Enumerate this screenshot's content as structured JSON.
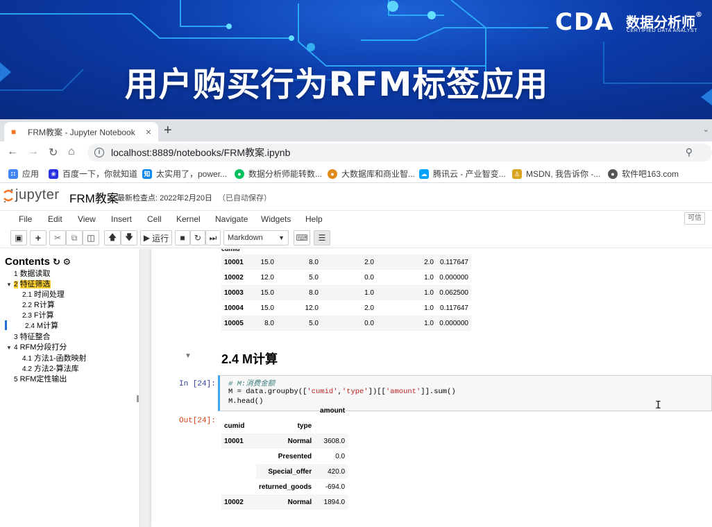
{
  "banner": {
    "title": "用户购买行为RFM标签应用",
    "logo_text": "CDA",
    "logo_cn": "数据分析师",
    "logo_en": "CERTIFIED DATA ANALYST",
    "logo_mark": "®"
  },
  "browser": {
    "tab_title": "FRM教案 - Jupyter Notebook",
    "tab_close": "×",
    "new_tab": "+",
    "url": "localhost:8889/notebooks/FRM教案.ipynb",
    "bookmarks": [
      {
        "label": "应用",
        "icon": "apps-grid-icon",
        "color": "#4285f4"
      },
      {
        "label": "百度一下，你就知道",
        "icon": "baidu-paw-icon",
        "color": "#2932e1"
      },
      {
        "label": "太实用了，power...",
        "icon": "zhihu-icon",
        "color": "#0f88eb"
      },
      {
        "label": "数据分析师能转数...",
        "icon": "wechat-icon",
        "color": "#07c160"
      },
      {
        "label": "大数据库和商业智...",
        "icon": "globe-icon",
        "color": "#e08a1e"
      },
      {
        "label": "腾讯云 - 产业智变...",
        "icon": "tencent-cloud-icon",
        "color": "#00a3ff"
      },
      {
        "label": "MSDN, 我告诉你 -...",
        "icon": "msdn-figure-icon",
        "color": "#d9a521"
      },
      {
        "label": "软件吧163.com",
        "icon": "site-globe-icon",
        "color": "#555555"
      }
    ]
  },
  "jupyter": {
    "logo_word": "jupyter",
    "notebook_name": "FRM教案",
    "checkpoint": "最新检查点: 2022年2月20日",
    "autosave": "（已自动保存）",
    "menus": [
      "File",
      "Edit",
      "View",
      "Insert",
      "Cell",
      "Kernel",
      "Navigate",
      "Widgets",
      "Help"
    ],
    "trusted": "可信",
    "run_label": "运行",
    "cell_type": "Markdown"
  },
  "toc": {
    "title": "Contents",
    "items": [
      {
        "num": "1",
        "label": "数据读取"
      },
      {
        "num": "2",
        "label": "特征筛选"
      },
      {
        "num": "2.1",
        "label": "时间处理"
      },
      {
        "num": "2.2",
        "label": "R计算"
      },
      {
        "num": "2.3",
        "label": "F计算"
      },
      {
        "num": "2.4",
        "label": "M计算"
      },
      {
        "num": "3",
        "label": "特征整合"
      },
      {
        "num": "4",
        "label": "RFM分段打分"
      },
      {
        "num": "4.1",
        "label": "方法1-函数映射"
      },
      {
        "num": "4.2",
        "label": "方法2-算法库"
      },
      {
        "num": "5",
        "label": "RFM定性输出"
      }
    ]
  },
  "cells": {
    "top_table": {
      "index_name": "cumid",
      "rows": [
        [
          "10001",
          "15.0",
          "8.0",
          "2.0",
          "2.0",
          "0.117647"
        ],
        [
          "10002",
          "12.0",
          "5.0",
          "0.0",
          "1.0",
          "0.000000"
        ],
        [
          "10003",
          "15.0",
          "8.0",
          "1.0",
          "1.0",
          "0.062500"
        ],
        [
          "10004",
          "15.0",
          "12.0",
          "2.0",
          "1.0",
          "0.117647"
        ],
        [
          "10005",
          "8.0",
          "5.0",
          "0.0",
          "1.0",
          "0.000000"
        ]
      ]
    },
    "heading": "2.4  M计算",
    "in_prompt": "In  [24]:",
    "code": {
      "comment": "# M:消费金额",
      "line2_a": "M = data.groupby([",
      "line2_s1": "'cumid'",
      "line2_b": ",",
      "line2_s2": "'type'",
      "line2_c": "])[[",
      "line2_s3": "'amount'",
      "line2_d": "]].sum()",
      "line3": "M.head()"
    },
    "out_prompt": "Out[24]:",
    "m_table": {
      "column": "amount",
      "index_names": [
        "cumid",
        "type"
      ],
      "rows": [
        {
          "cumid": "10001",
          "type": "Normal",
          "amount": "3608.0"
        },
        {
          "cumid": "",
          "type": "Presented",
          "amount": "0.0"
        },
        {
          "cumid": "",
          "type": "Special_offer",
          "amount": "420.0"
        },
        {
          "cumid": "",
          "type": "returned_goods",
          "amount": "-694.0"
        },
        {
          "cumid": "10002",
          "type": "Normal",
          "amount": "1894.0"
        }
      ]
    }
  }
}
